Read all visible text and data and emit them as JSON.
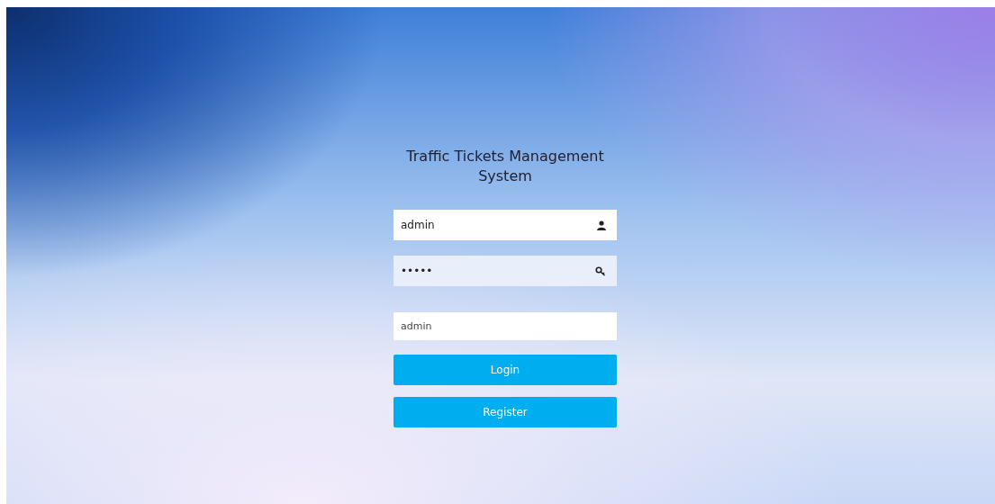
{
  "title": "Traffic Tickets Management System",
  "fields": [
    {
      "kind": "text",
      "value": "admin"
    },
    {
      "kind": "password",
      "value": "•••••"
    },
    {
      "kind": "select",
      "value": "admin"
    }
  ],
  "buttons": [
    {
      "label": "Login"
    },
    {
      "label": "Register"
    }
  ]
}
